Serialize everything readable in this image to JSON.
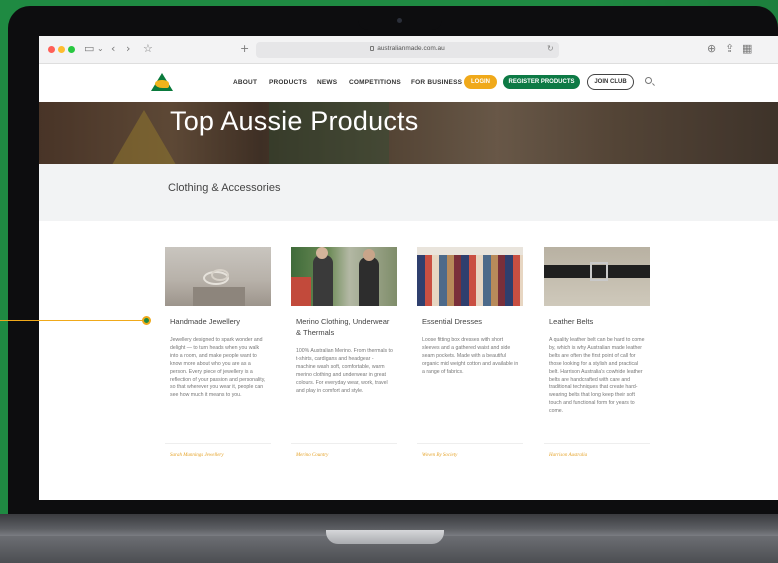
{
  "browser": {
    "url": "australianmade.com.au"
  },
  "nav": {
    "links": [
      "ABOUT",
      "PRODUCTS",
      "NEWS",
      "COMPETITIONS",
      "FOR BUSINESS"
    ],
    "login": "LOGIN",
    "register": "REGISTER PRODUCTS",
    "join": "JOIN CLUB"
  },
  "hero": {
    "title": "Top Aussie Products"
  },
  "category": {
    "title": "Clothing & Accessories"
  },
  "cards": [
    {
      "title": "Handmade Jewellery",
      "body": "Jewellery designed to spark wonder and delight — to turn heads when you walk into a room, and make people want to know more about who you are as a person. Every piece of jewellery is a reflection of your passion and personality, so that wherever you wear it, people can see how much it means to you.",
      "brand": "Sarah Munnings Jewellery"
    },
    {
      "title": "Merino Clothing, Underwear & Thermals",
      "body": "100% Australian Merino. From thermals to t-shirts, cardigans and headgear - machine wash soft, comfortable, warm merino clothing and underwear in great colours. For everyday wear, work, travel and play in comfort and style.",
      "brand": "Merino Country"
    },
    {
      "title": "Essential Dresses",
      "body": "Loose fitting box dresses with short sleeves and a gathered waist and side seam pockets. Made with a beautiful organic mid weight cotton and available in a range of fabrics.",
      "brand": "Woven By Society"
    },
    {
      "title": "Leather Belts",
      "body": "A quality leather belt can be hard to come by, which is why Australian made leather belts are often the first point of call for those looking for a stylish and practical belt. Harrison Australia's cowhide leather belts are handcrafted with care and traditional techniques that create hard-wearing belts that long keep their soft touch and functional form for years to come.",
      "brand": "Harrison Australia"
    }
  ],
  "colors": {
    "background_green": "#1f8a42",
    "login_orange": "#f0a91a",
    "register_green": "#0d7a45",
    "brand_gold": "#e5a329"
  }
}
